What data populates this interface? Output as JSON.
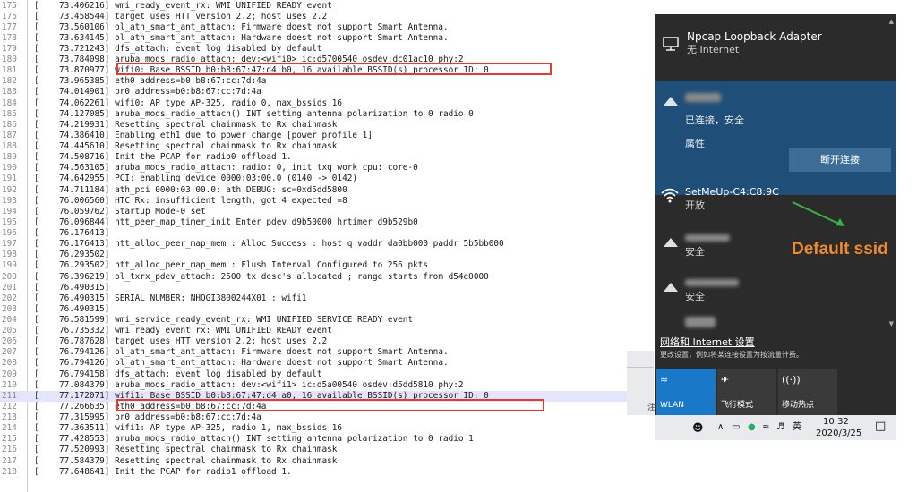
{
  "log": {
    "lines": [
      {
        "n": "175",
        "t": "73.406216] wmi_ready_event_rx:  WMI UNIFIED READY event"
      },
      {
        "n": "176",
        "t": "73.458544] target uses HTT version 2.2; host uses 2.2"
      },
      {
        "n": "177",
        "t": "73.560106] ol_ath_smart_ant_attach: Firmware doest not support Smart Antenna."
      },
      {
        "n": "178",
        "t": "73.634145] ol_ath_smart_ant_attach: Hardware doest not support Smart Antenna."
      },
      {
        "n": "179",
        "t": "73.721243] dfs_attach: event log disabled by default"
      },
      {
        "n": "180",
        "t": "73.784098] aruba_mods_radio_attach: dev:<wifi0> ic:d5700540 osdev:dc01ac10 phy:2"
      },
      {
        "n": "181",
        "t": "73.870977] wifi0: Base BSSID b0:b8:67:47:d4:b0, 16 available BSSID(s) processor ID: 0"
      },
      {
        "n": "182",
        "t": "73.965385] eth0 address=b0:b8:67:cc:7d:4a"
      },
      {
        "n": "183",
        "t": "74.014901] br0 address=b0:b8:67:cc:7d:4a"
      },
      {
        "n": "184",
        "t": "74.062261] wifi0: AP type AP-325, radio 0, max_bssids 16"
      },
      {
        "n": "185",
        "t": "74.127085] aruba_mods_radio_attach() INT  setting antenna polarization to 0 radio 0"
      },
      {
        "n": "186",
        "t": "74.219931] Resetting spectral chainmask to Rx chainmask"
      },
      {
        "n": "187",
        "t": "74.386410] Enabling eth1 due to power change [power profile 1]"
      },
      {
        "n": "188",
        "t": "74.445610] Resetting spectral chainmask to Rx chainmask"
      },
      {
        "n": "189",
        "t": "74.508716] Init the PCAP for radio0 offload 1."
      },
      {
        "n": "190",
        "t": "74.563105] aruba_mods_radio_attach: radio: 0, init txq work cpu: core-0"
      },
      {
        "n": "191",
        "t": "74.642955] PCI: enabling device 0000:03:00.0 (0140 -> 0142)"
      },
      {
        "n": "192",
        "t": "74.711184] ath_pci 0000:03:00.0: ath DEBUG: sc=0xd5dd5800"
      },
      {
        "n": "193",
        "t": "76.006560] HTC Rx: insufficient length, got:4 expected =8"
      },
      {
        "n": "194",
        "t": "76.059762] Startup Mode-0 set"
      },
      {
        "n": "195",
        "t": "76.096844] htt_peer_map_timer_init Enter pdev d9b50000 hrtimer d9b529b0"
      },
      {
        "n": "196",
        "t": "76.176413]"
      },
      {
        "n": "197",
        "t": "76.176413]  htt_alloc_peer_map_mem : Alloc Success : host q vaddr da0bb000 paddr 5b5bb000"
      },
      {
        "n": "198",
        "t": "76.293502]"
      },
      {
        "n": "199",
        "t": "76.293502]  htt_alloc_peer_map_mem : Flush Interval Configured to 256 pkts"
      },
      {
        "n": "200",
        "t": "76.396219] ol_txrx_pdev_attach: 2500 tx desc's allocated ; range starts from d54e0000"
      },
      {
        "n": "201",
        "t": "76.490315]"
      },
      {
        "n": "202",
        "t": "76.490315] SERIAL NUMBER: NHQGI3800244X01 : wifi1"
      },
      {
        "n": "203",
        "t": "76.490315]"
      },
      {
        "n": "204",
        "t": "76.581599] wmi_service_ready_event_rx:  WMI UNIFIED SERVICE READY event"
      },
      {
        "n": "205",
        "t": "76.735332] wmi_ready_event_rx:  WMI UNIFIED READY event"
      },
      {
        "n": "206",
        "t": "76.787628] target uses HTT version 2.2; host uses 2.2"
      },
      {
        "n": "207",
        "t": "76.794126] ol_ath_smart_ant_attach: Firmware doest not support Smart Antenna."
      },
      {
        "n": "208",
        "t": "76.794126] ol_ath_smart_ant_attach: Hardware doest not support Smart Antenna."
      },
      {
        "n": "209",
        "t": "76.794158] dfs_attach: event log disabled by default"
      },
      {
        "n": "210",
        "t": "77.084379] aruba_mods_radio_attach: dev:<wifi1> ic:d5a00540 osdev:d5dd5810 phy:2"
      },
      {
        "n": "211",
        "t": "77.172071] wifi1: Base BSSID b0:b8:67:47:d4:a0, 16 available BSSID(s) processor ID: 0"
      },
      {
        "n": "212",
        "t": "77.266635] eth0 address=b0:b8:67:cc:7d:4a"
      },
      {
        "n": "213",
        "t": "77.315995] br0 address=b0:b8:67:cc:7d:4a"
      },
      {
        "n": "214",
        "t": "77.363511] wifi1: AP type AP-325, radio 1, max_bssids 16"
      },
      {
        "n": "215",
        "t": "77.428553] aruba_mods_radio_attach() INT  setting antenna polarization to 0 radio 1"
      },
      {
        "n": "216",
        "t": "77.520993] Resetting spectral chainmask to Rx chainmask"
      },
      {
        "n": "217",
        "t": "77.584379] Resetting spectral chainmask to Rx chainmask"
      },
      {
        "n": "218",
        "t": "77.648641] Init the PCAP for radio1 offload 1."
      }
    ],
    "bracket": "[",
    "current_line": "211",
    "highlighted_lines": [
      "181",
      "211"
    ]
  },
  "flyout": {
    "loopback_title": "Npcap Loopback Adapter",
    "loopback_status": "无 Internet",
    "connected_status": "已连接，安全",
    "properties_label": "属性",
    "disconnect_label": "断开连接",
    "setmeup_name": "SetMeUp-C4:C8:9C",
    "setmeup_status": "开放",
    "net3_status": "安全",
    "net4_status": "安全",
    "settings_link": "网络和 Internet 设置",
    "settings_desc": "更改设置，例如将某连接设置为按流量计费。",
    "quick": [
      {
        "label": "WLAN",
        "icon": "wifi-icon"
      },
      {
        "label": "飞行模式",
        "icon": "airplane-icon"
      },
      {
        "label": "移动热点",
        "icon": "hotspot-icon"
      }
    ],
    "colors": {
      "panel": "#2b2b2b",
      "connected": "#1f4f78",
      "accent": "#1a78c9",
      "disconnect": "#3d6d97"
    }
  },
  "taskbar": {
    "ime": "英",
    "time": "10:32",
    "date": "2020/3/25"
  },
  "background_window": {
    "note": "注"
  },
  "annotation": {
    "text": "Default ssid",
    "color": "#f08a2a"
  }
}
